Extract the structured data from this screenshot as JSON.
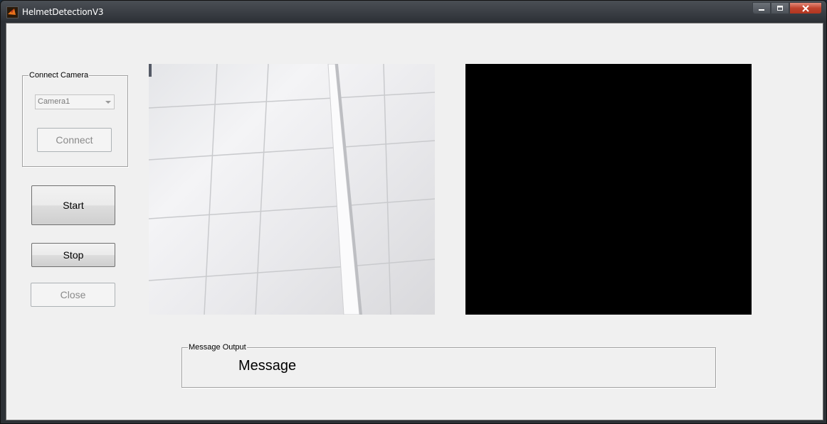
{
  "window": {
    "title": "HelmetDetectionV3",
    "icon": "matlab-icon",
    "controls": [
      "minimize-icon",
      "maximize-icon",
      "close-icon"
    ]
  },
  "connect_camera": {
    "group_title": "Connect Camera",
    "camera_select": "Camera1",
    "connect_label": "Connect"
  },
  "controls": {
    "start_label": "Start",
    "stop_label": "Stop",
    "close_label": "Close"
  },
  "message_output": {
    "group_title": "Message Output",
    "text": "Message"
  },
  "colors": {
    "client_bg": "#f0f0f0",
    "right_video_bg": "#000000",
    "close_button": "#c0432d"
  }
}
